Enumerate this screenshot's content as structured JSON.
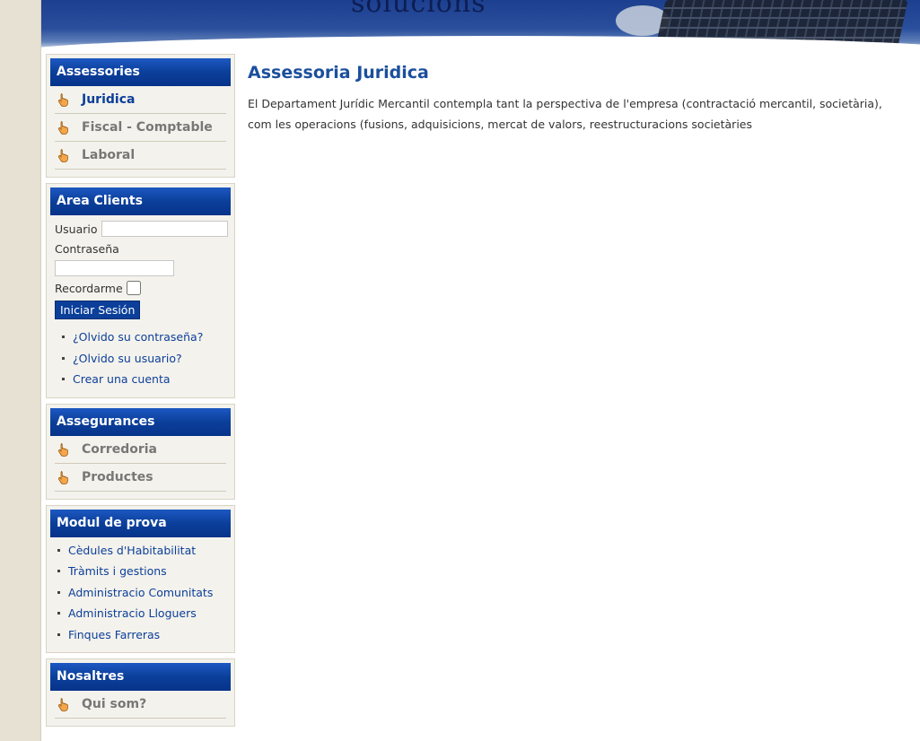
{
  "banner": {
    "logo_text": "solucions"
  },
  "sidebar": {
    "assessories": {
      "title": "Assessories",
      "items": [
        {
          "label": "Juridica",
          "active": true
        },
        {
          "label": "Fiscal - Comptable"
        },
        {
          "label": "Laboral"
        }
      ]
    },
    "area_clients": {
      "title": "Area Clients",
      "usuario_label": "Usuario",
      "usuario_value": "",
      "password_label": "Contraseña",
      "password_value": "",
      "remember_label": "Recordarme",
      "login_button": "Iniciar Sesión",
      "links": [
        "¿Olvido su contraseña?",
        "¿Olvido su usuario?",
        "Crear una cuenta"
      ]
    },
    "assegurances": {
      "title": "Assegurances",
      "items": [
        {
          "label": "Corredoria"
        },
        {
          "label": "Productes"
        }
      ]
    },
    "modul_de_prova": {
      "title": "Modul de prova",
      "links": [
        "Cèdules d'Habitabilitat",
        "Tràmits i gestions",
        "Administracio Comunitats",
        "Administracio Lloguers",
        "Finques Farreras"
      ]
    },
    "nosaltres": {
      "title": "Nosaltres",
      "items": [
        {
          "label": "Qui som?"
        }
      ]
    }
  },
  "content": {
    "title": "Assessoria Juridica",
    "body": "El Departament Jurídic Mercantil contempla tant la perspectiva de l'empresa (contractació mercantil, societària), com les operacions (fusions, adquisicions, mercat de valors, reestructuracions societàries"
  },
  "colors": {
    "accent": "#0b3f9a",
    "title_blue": "#1b4f9c",
    "sidebar_bg": "#f4f2ec",
    "page_bg": "#e6e1d3"
  },
  "icons": {
    "menu_item": "pointing-hand-icon",
    "list_bullet": "bullet-icon"
  }
}
